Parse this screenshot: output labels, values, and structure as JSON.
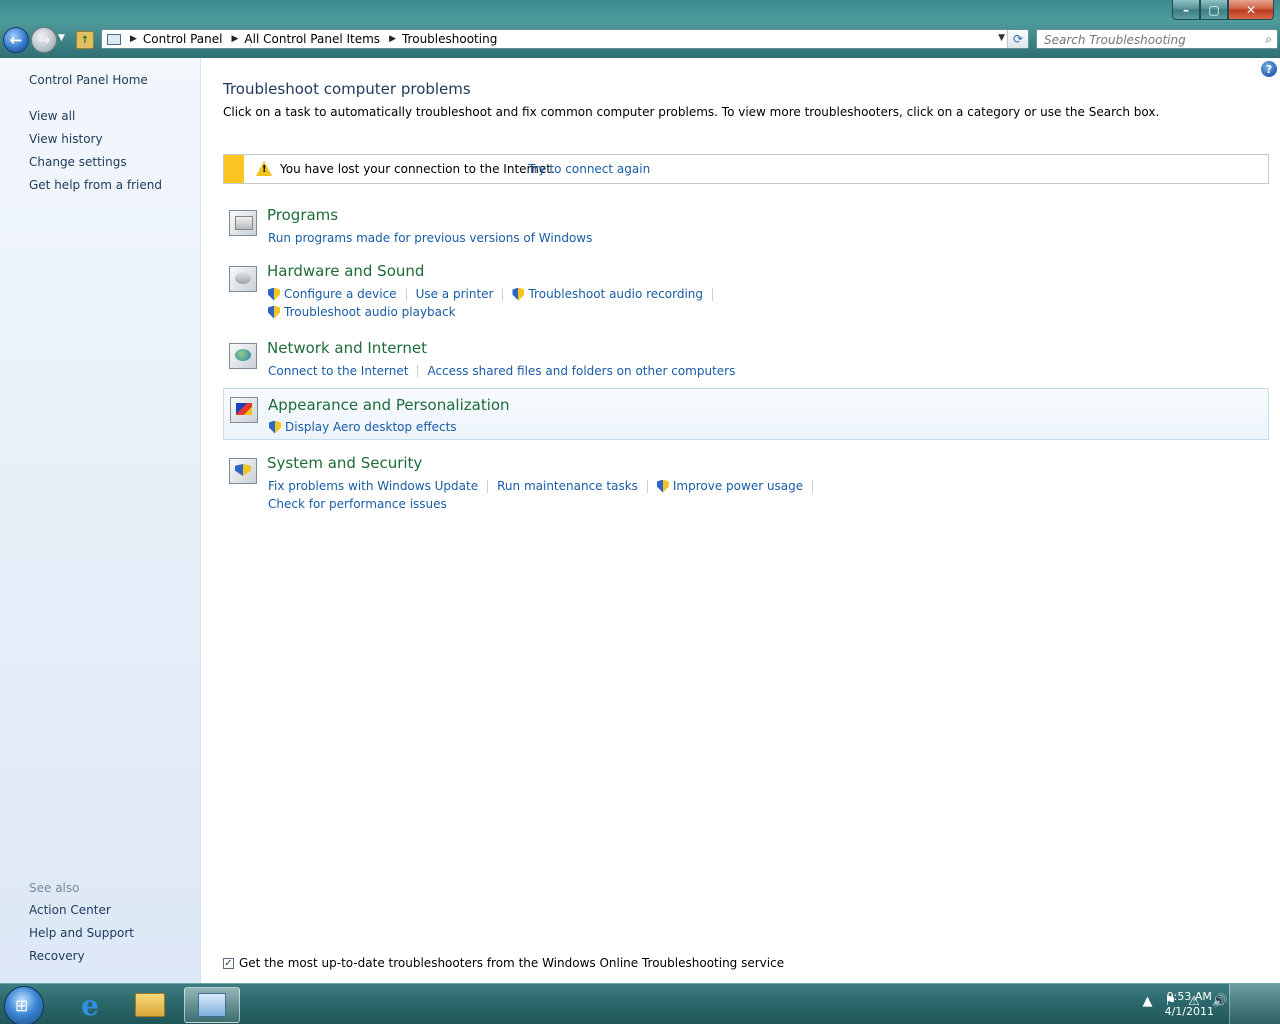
{
  "window": {
    "title_buttons": {
      "minimize": "–",
      "maximize": "▢",
      "close": "✕"
    }
  },
  "nav": {
    "back": "←",
    "forward": "→",
    "breadcrumb": [
      "Control Panel",
      "All Control Panel Items",
      "Troubleshooting"
    ],
    "search_placeholder": "Search Troubleshooting"
  },
  "sidebar": {
    "home": "Control Panel Home",
    "items": [
      "View all",
      "View history",
      "Change settings",
      "Get help from a friend"
    ],
    "see_also_label": "See also",
    "see_also": [
      "Action Center",
      "Help and Support",
      "Recovery"
    ]
  },
  "main": {
    "title": "Troubleshoot computer problems",
    "description": "Click on a task to automatically troubleshoot and fix common computer problems. To view more troubleshooters, click on a category or use the Search box.",
    "warning": {
      "message": "You have lost your connection to the Internet.",
      "action": "Try to connect again"
    },
    "categories": [
      {
        "title": "Programs",
        "rows": [
          [
            {
              "label": "Run programs made for previous versions of Windows",
              "shield": false
            }
          ]
        ]
      },
      {
        "title": "Hardware and Sound",
        "rows": [
          [
            {
              "label": "Configure a device",
              "shield": true
            },
            {
              "label": "Use a printer",
              "shield": false
            },
            {
              "label": "Troubleshoot audio recording",
              "shield": true
            }
          ],
          [
            {
              "label": "Troubleshoot audio playback",
              "shield": true
            }
          ]
        ]
      },
      {
        "title": "Network and Internet",
        "rows": [
          [
            {
              "label": "Connect to the Internet",
              "shield": false
            },
            {
              "label": "Access shared files and folders on other computers",
              "shield": false
            }
          ]
        ]
      },
      {
        "title": "Appearance and Personalization",
        "rows": [
          [
            {
              "label": "Display Aero desktop effects",
              "shield": true
            }
          ]
        ]
      },
      {
        "title": "System and Security",
        "rows": [
          [
            {
              "label": "Fix problems with Windows Update",
              "shield": false
            },
            {
              "label": "Run maintenance tasks",
              "shield": false
            },
            {
              "label": "Improve power usage",
              "shield": true
            }
          ],
          [
            {
              "label": "Check for performance issues",
              "shield": false
            }
          ]
        ]
      }
    ],
    "footer_checkbox": {
      "label": "Get the most up-to-date troubleshooters from the Windows Online Troubleshooting service",
      "checked": true
    }
  },
  "taskbar": {
    "time": "9:53 AM",
    "date": "4/1/2011"
  },
  "colors": {
    "link": "#1a5ba6",
    "category_title": "#1e6b3a",
    "warning_stripe": "#fbc624"
  }
}
